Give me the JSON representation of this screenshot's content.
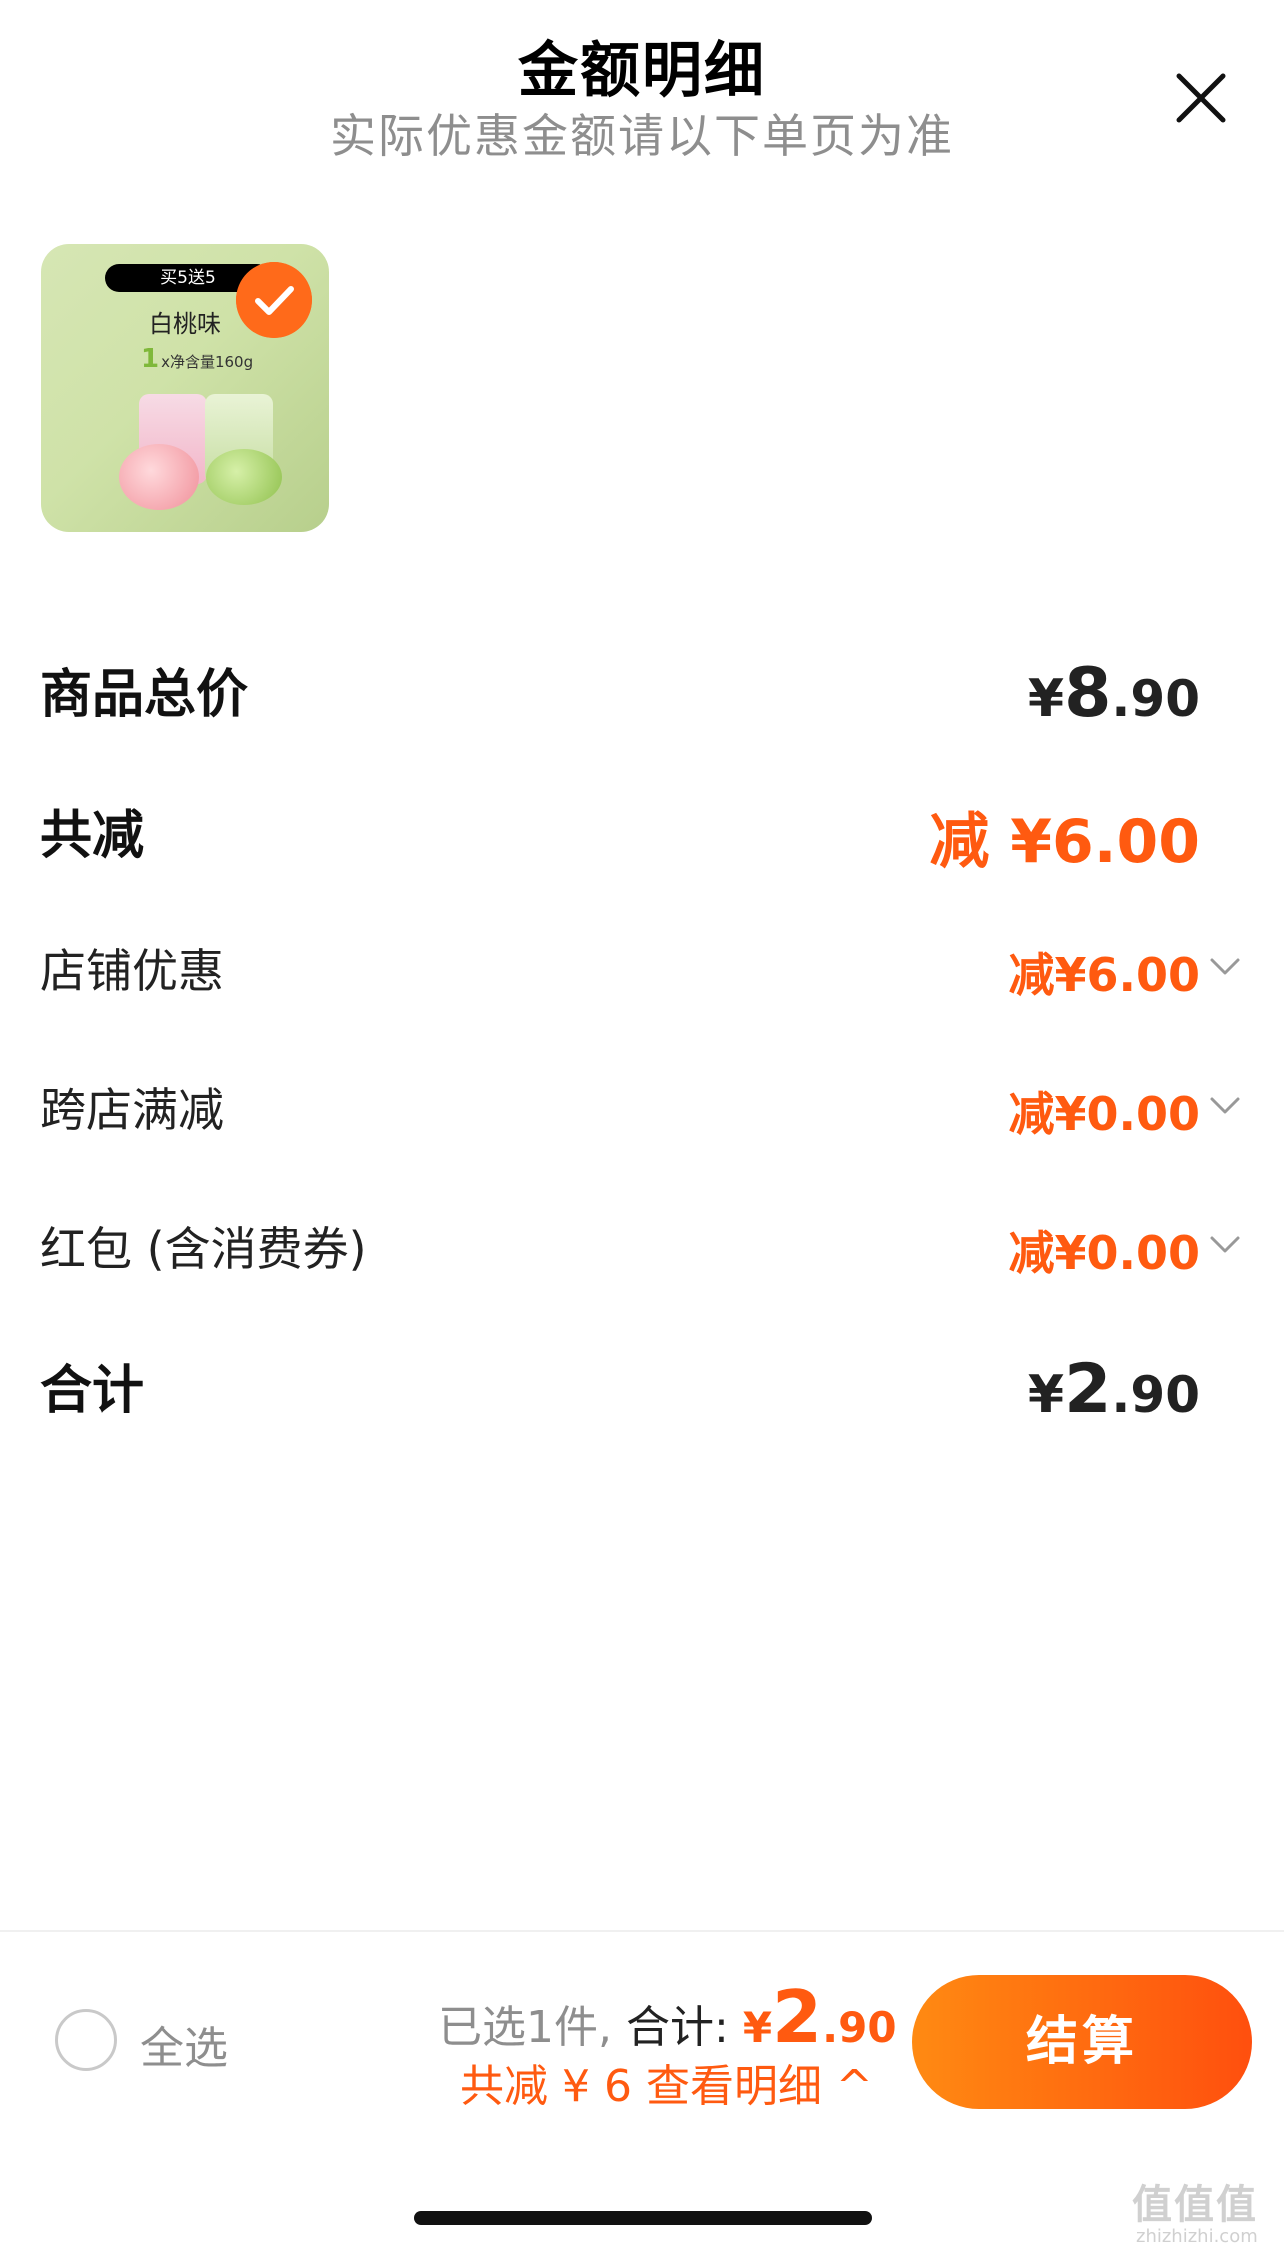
{
  "header": {
    "title": "金额明细",
    "subtitle": "实际优惠金额请以下单页为准",
    "close_icon": "close-icon"
  },
  "product": {
    "promo_tag": "买5送5",
    "flavor": "白桃味",
    "count": "1",
    "spec": "x净含量160g",
    "selected": true,
    "check_icon": "checkmark-icon"
  },
  "rows": {
    "total_price": {
      "label": "商品总价",
      "yen": "¥",
      "int": "8",
      "dec": ".90"
    },
    "total_reduce": {
      "label": "共减",
      "value": "减 ¥6.00"
    },
    "shop_discount": {
      "label": "店铺优惠",
      "value": "减¥6.00"
    },
    "cross_store": {
      "label": "跨店满减",
      "value": "减¥0.00"
    },
    "red_packet": {
      "label": "红包 (含消费券)",
      "value": "减¥0.00"
    },
    "sum": {
      "label": "合计",
      "yen": "¥",
      "int": "2",
      "dec": ".90"
    }
  },
  "bottom": {
    "select_all": "全选",
    "selected_text": "已选1件,",
    "total_label": "合计:",
    "yen": "¥",
    "int": "2",
    "dec": ".90",
    "detail_link": "共减 ¥ 6  查看明细 ^",
    "checkout": "结算"
  },
  "watermark": {
    "text": "值值值",
    "sub": "zhizhizhi.com"
  },
  "colors": {
    "accent": "#ff5a10",
    "checkout_from": "#ff8a12",
    "checkout_to": "#ff4f0e"
  }
}
